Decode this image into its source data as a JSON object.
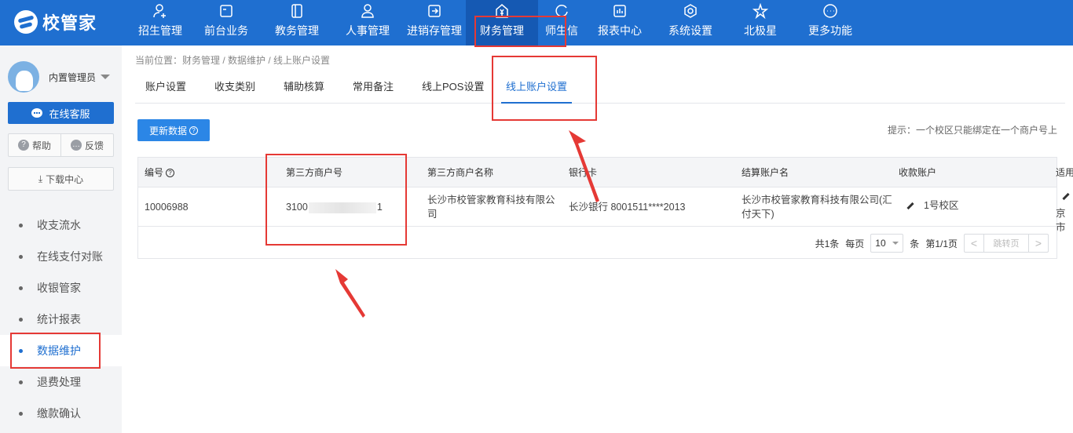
{
  "app": {
    "logo_text": "校管家"
  },
  "nav": [
    {
      "label": "招生管理",
      "icon": "person-add-icon"
    },
    {
      "label": "前台业务",
      "icon": "desk-icon"
    },
    {
      "label": "教务管理",
      "icon": "book-icon"
    },
    {
      "label": "人事管理",
      "icon": "person-icon"
    },
    {
      "label": "进销存管理",
      "icon": "inventory-icon"
    },
    {
      "label": "财务管理",
      "icon": "yen-icon",
      "active": true
    },
    {
      "label": "师生信",
      "icon": "message-icon"
    },
    {
      "label": "报表中心",
      "icon": "chart-icon"
    },
    {
      "label": "系统设置",
      "icon": "settings-icon"
    },
    {
      "label": "北极星",
      "icon": "star-icon"
    },
    {
      "label": "更多功能",
      "icon": "more-icon"
    }
  ],
  "sidebar": {
    "user_name": "内置管理员",
    "online_service": "在线客服",
    "help": "帮助",
    "feedback": "反馈",
    "download_center": "下载中心",
    "menu": [
      {
        "label": "收支流水"
      },
      {
        "label": "在线支付对账"
      },
      {
        "label": "收银管家"
      },
      {
        "label": "统计报表"
      },
      {
        "label": "数据维护",
        "active": true
      },
      {
        "label": "退费处理"
      },
      {
        "label": "缴款确认"
      }
    ]
  },
  "breadcrumb": "当前位置：财务管理 / 数据维护 / 线上账户设置",
  "tabs": [
    {
      "label": "账户设置"
    },
    {
      "label": "收支类别"
    },
    {
      "label": "辅助核算"
    },
    {
      "label": "常用备注"
    },
    {
      "label": "线上POS设置"
    },
    {
      "label": "线上账户设置",
      "active": true
    }
  ],
  "refresh_button": "更新数据",
  "hint": "提示：一个校区只能绑定在一个商户号上",
  "table": {
    "headers": [
      "编号",
      "第三方商户号",
      "第三方商户名称",
      "银行卡",
      "结算账户名",
      "收款账户",
      "适用"
    ],
    "row": {
      "id": "10006988",
      "merchant_no_prefix": "3100",
      "merchant_no_suffix": "1",
      "merchant_name_line1": "长沙市校管家教育科技有限公",
      "merchant_name_line2": "司",
      "bank_card": "长沙银行 8001511****2013",
      "settle_name_line1": "长沙市校管家教育科技有限公司(汇",
      "settle_name_line2": "付天下)",
      "receive_account": "1号校区",
      "apply_text": "京市"
    }
  },
  "pager": {
    "total": "共1条",
    "per_page_label": "每页",
    "per_page_value": "10",
    "unit": "条",
    "page_info": "第1/1页",
    "prev": "<",
    "jump": "跳转页",
    "next": ">"
  },
  "colors": {
    "primary": "#1f6fd0",
    "highlight": "#e53935"
  }
}
